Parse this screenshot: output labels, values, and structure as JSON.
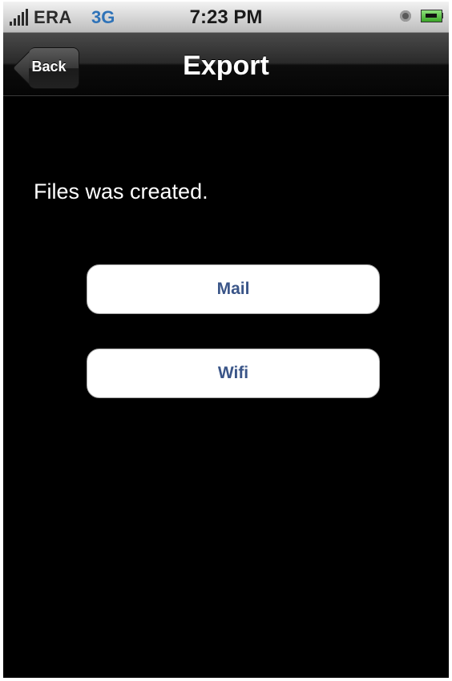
{
  "status_bar": {
    "carrier": "ERA",
    "network": "3G",
    "time": "7:23 PM",
    "icons": [
      "signal-bars-icon",
      "alarm-clock-icon",
      "battery-charging-icon"
    ],
    "network_color": "#2f73b8"
  },
  "nav": {
    "back_label": "Back",
    "title": "Export"
  },
  "main": {
    "message": "Files was created.",
    "buttons": [
      {
        "label": "Mail"
      },
      {
        "label": "Wifi"
      }
    ],
    "button_text_color": "#3a5588"
  }
}
